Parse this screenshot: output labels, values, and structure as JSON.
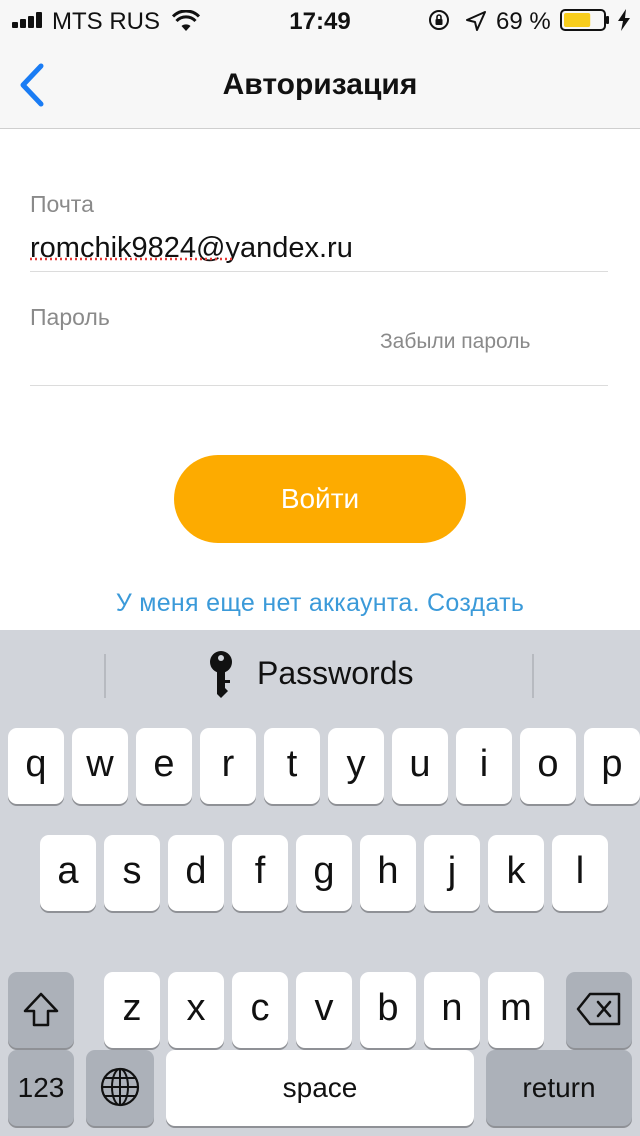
{
  "status_bar": {
    "carrier": "MTS RUS",
    "time": "17:49",
    "battery_percent": "69 %",
    "battery_level": 0.69,
    "icons": [
      "signal-icon",
      "wifi-icon",
      "orientation-lock-icon",
      "location-icon",
      "battery-icon",
      "charging-icon"
    ]
  },
  "nav": {
    "title": "Авторизация",
    "back_icon": "chevron-left-icon"
  },
  "form": {
    "email_label": "Почта",
    "email_value": "romchik9824@yandex.ru",
    "password_label": "Пароль",
    "password_value": "",
    "forgot_label": "Забыли пароль"
  },
  "actions": {
    "login_label": "Войти",
    "register_label": "У меня еще нет аккаунта. Создать"
  },
  "colors": {
    "accent": "#fdab00",
    "link": "#3b9ad9",
    "back": "#1a7cf4"
  },
  "keyboard": {
    "passwords_label": "Passwords",
    "row1": [
      "q",
      "w",
      "e",
      "r",
      "t",
      "y",
      "u",
      "i",
      "o",
      "p"
    ],
    "row2": [
      "a",
      "s",
      "d",
      "f",
      "g",
      "h",
      "j",
      "k",
      "l"
    ],
    "row3": [
      "z",
      "x",
      "c",
      "v",
      "b",
      "n",
      "m"
    ],
    "numbers_label": "123",
    "space_label": "space",
    "return_label": "return",
    "icons": [
      "shift-icon",
      "backspace-icon",
      "globe-icon",
      "key-icon"
    ]
  }
}
